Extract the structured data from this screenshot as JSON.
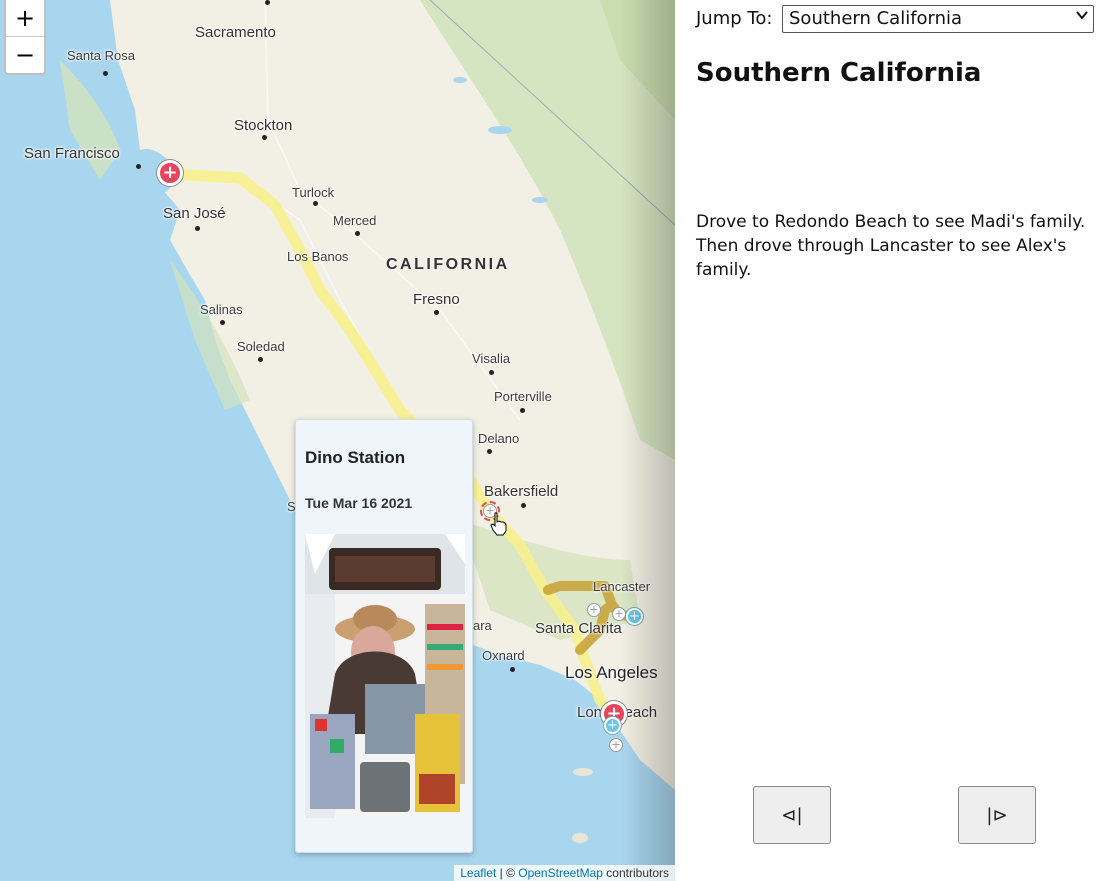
{
  "map": {
    "zoom_in_label": "+",
    "zoom_out_label": "−",
    "state_label": "CALIFORNIA",
    "cities": [
      {
        "name": "Sacramento",
        "size": "medium"
      },
      {
        "name": "Santa Rosa",
        "size": "small"
      },
      {
        "name": "Stockton",
        "size": "medium"
      },
      {
        "name": "San Francisco",
        "size": "medium"
      },
      {
        "name": "San José",
        "size": "medium"
      },
      {
        "name": "Turlock",
        "size": "small"
      },
      {
        "name": "Merced",
        "size": "small"
      },
      {
        "name": "Los Banos",
        "size": "small"
      },
      {
        "name": "Fresno",
        "size": "medium"
      },
      {
        "name": "Salinas",
        "size": "small"
      },
      {
        "name": "Soledad",
        "size": "small"
      },
      {
        "name": "Visalia",
        "size": "small"
      },
      {
        "name": "Porterville",
        "size": "small"
      },
      {
        "name": "Delano",
        "size": "small"
      },
      {
        "name": "Bakersfield",
        "size": "medium"
      },
      {
        "name": "Lancaster",
        "size": "small"
      },
      {
        "name": "Santa Clarita",
        "size": "medium"
      },
      {
        "name": "Oxnard",
        "size": "small"
      },
      {
        "name": "Los Angeles",
        "size": "large"
      },
      {
        "name": "Long Beach",
        "size": "medium"
      }
    ],
    "partial_labels": {
      "sa": "Sa",
      "ara": "ara"
    },
    "marker_plus": "+",
    "route_colors": {
      "main": "#f7ef90",
      "detour": "#c9a33c"
    },
    "water_color": "#a9d6ef",
    "popup": {
      "title": "Dino Station",
      "date": "Tue Mar 16 2021"
    },
    "attribution": {
      "leaflet": "Leaflet",
      "separator": " | © ",
      "osm": "OpenStreetMap",
      "suffix": " contributors"
    }
  },
  "panel": {
    "jump_label": "Jump To:",
    "selected_region": "Southern California",
    "title": "Southern California",
    "description": "Drove to Redondo Beach to see Madi's family. Then drove through Lancaster to see Alex's family.",
    "prev_label": "⊲|",
    "next_label": "|⊳"
  }
}
